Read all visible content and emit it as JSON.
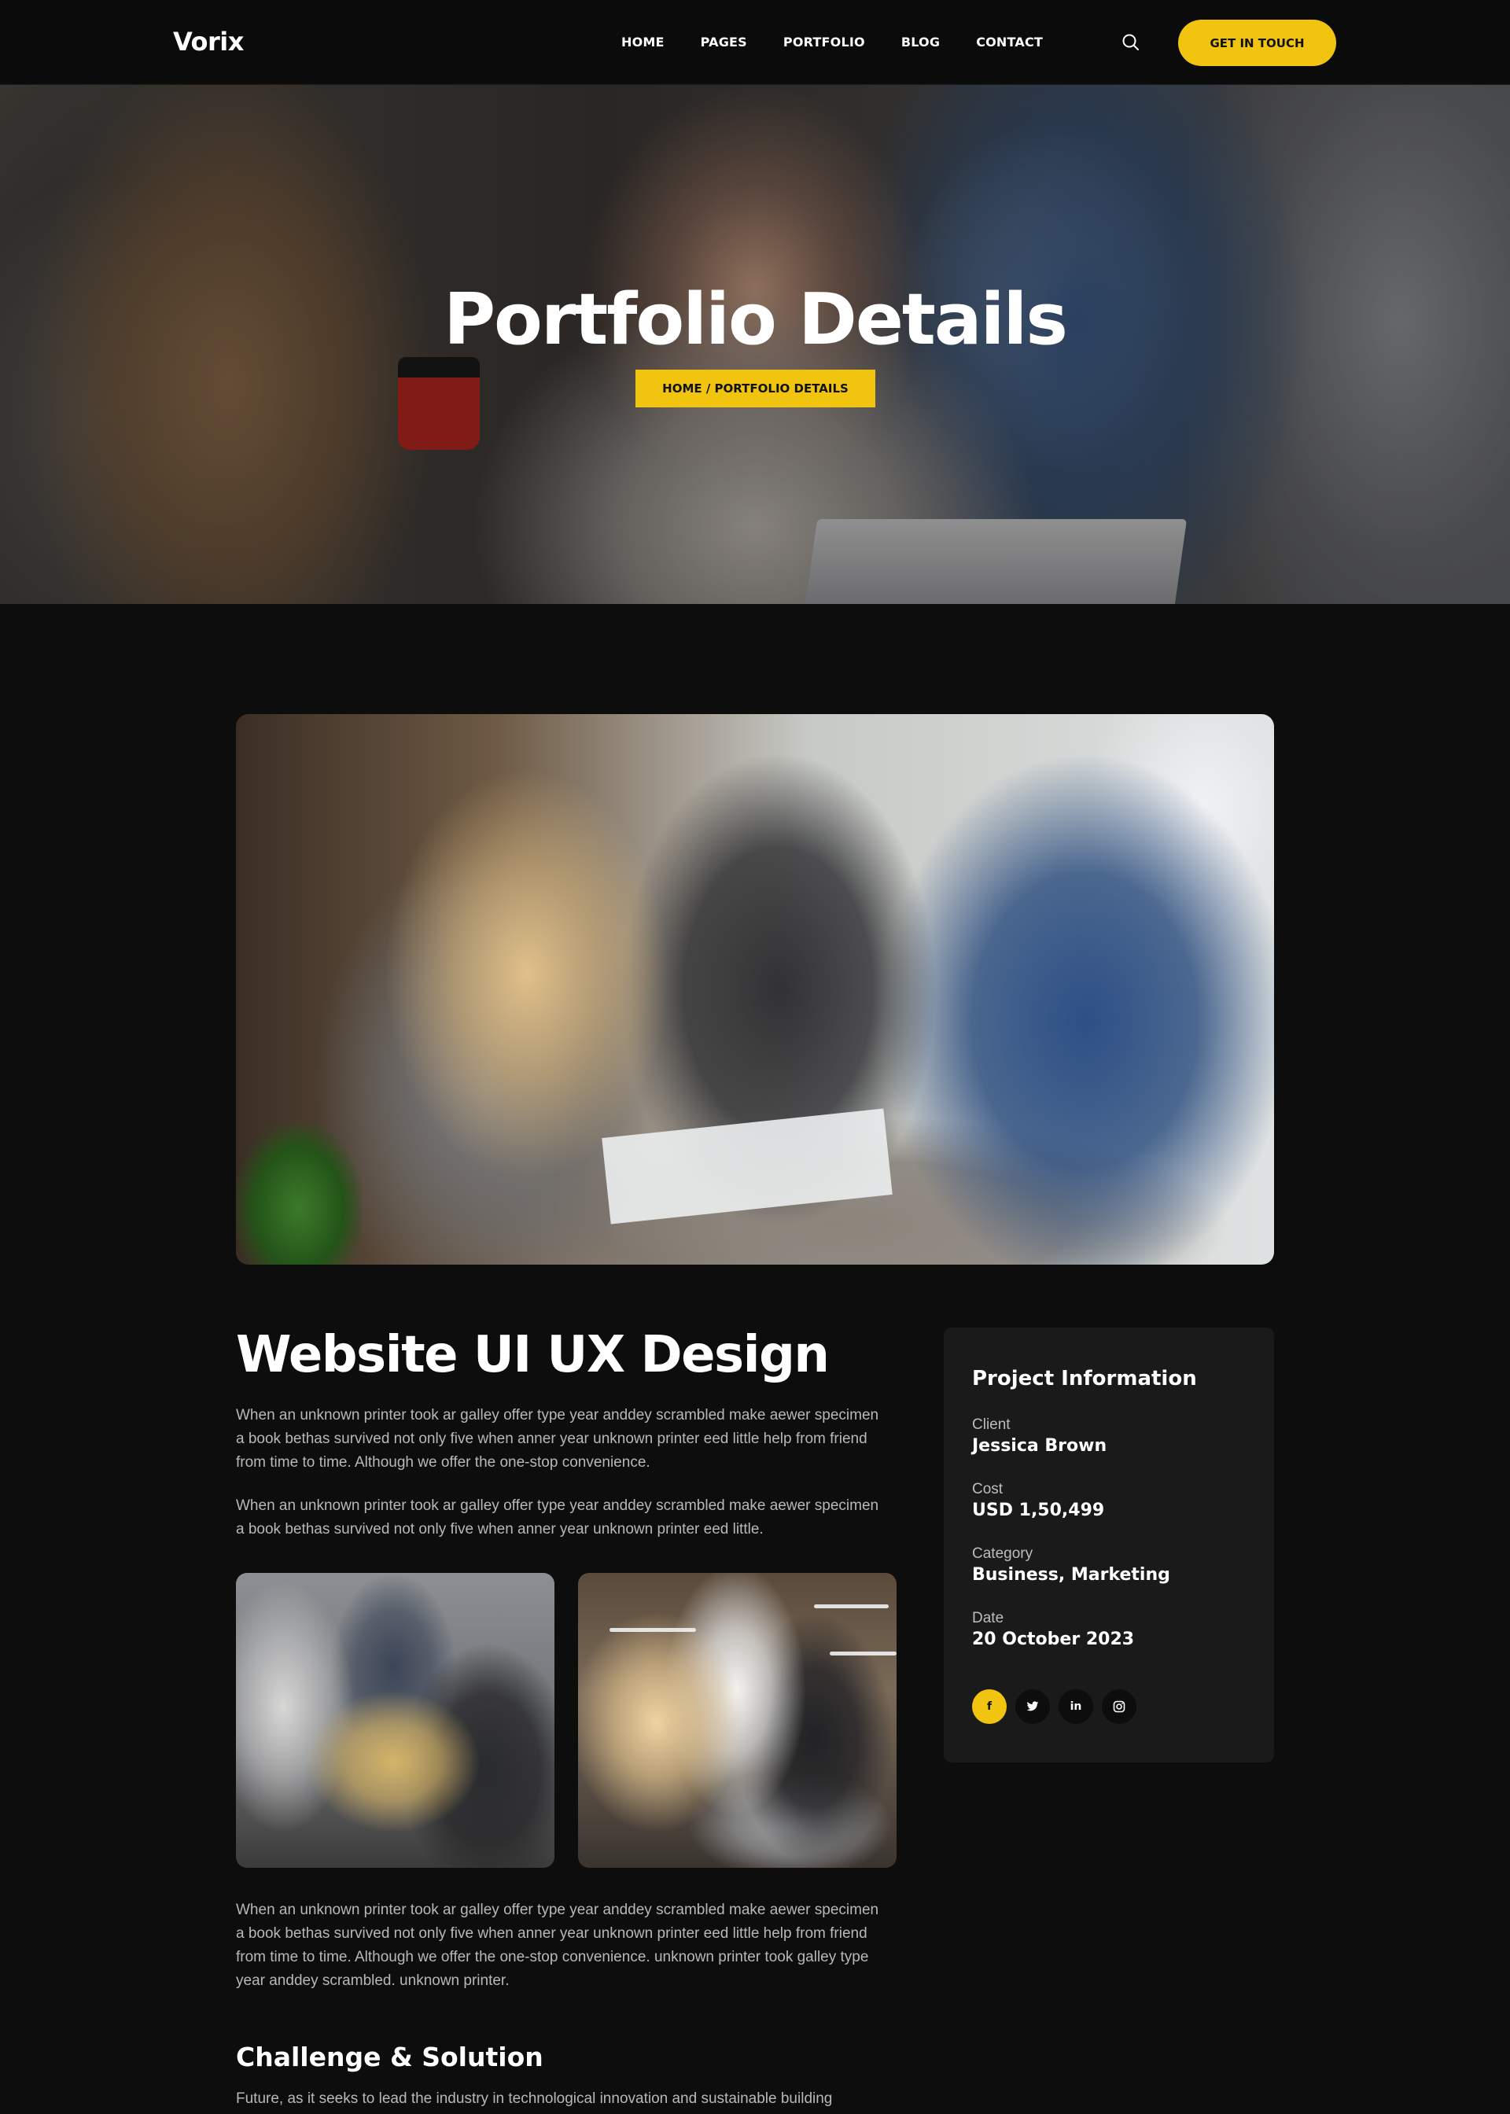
{
  "header": {
    "logo": "Vorix",
    "nav": [
      "HOME",
      "PAGES",
      "PORTFOLIO",
      "BLOG",
      "CONTACT"
    ],
    "cta_label": "GET IN TOUCH",
    "search_icon": "search-icon"
  },
  "hero": {
    "title": "Portfolio Details",
    "breadcrumb": "HOME / PORTFOLIO DETAILS"
  },
  "project": {
    "title": "Website UI UX Design",
    "paragraphs": [
      "When an unknown printer took ar galley offer type year anddey scrambled make aewer specimen  a book bethas survived not only five when anner year unknown printer eed  little help from friend from time to time. Although we offer the one-stop convenience.",
      "When an unknown printer took ar galley offer type year anddey scrambled make aewer specimen  a book bethas survived not only five when anner year unknown printer eed  little.",
      "When an unknown printer took ar galley offer type year anddey scrambled make aewer specimen  a book bethas survived not only five when anner year unknown printer eed  little help from friend from time to time. Although we offer the one-stop convenience. unknown printer took galley type year anddey scrambled. unknown printer."
    ],
    "challenge_title": "Challenge & Solution",
    "challenge_text": "Future, as it seeks to lead the industry in technological innovation and sustainable building"
  },
  "info": {
    "title": "Project Information",
    "items": [
      {
        "label": "Client",
        "value": "Jessica Brown"
      },
      {
        "label": "Cost",
        "value": "USD 1,50,499"
      },
      {
        "label": "Category",
        "value": "Business, Marketing"
      },
      {
        "label": "Date",
        "value": "20 October 2023"
      }
    ],
    "social": [
      {
        "icon": "facebook-icon",
        "glyph": "f"
      },
      {
        "icon": "twitter-icon",
        "glyph": "t"
      },
      {
        "icon": "linkedin-icon",
        "glyph": "in"
      },
      {
        "icon": "instagram-icon",
        "glyph": "◎"
      }
    ]
  },
  "colors": {
    "accent": "#f1c40f",
    "background": "#0d0d0d",
    "card": "#1a1a1a"
  }
}
